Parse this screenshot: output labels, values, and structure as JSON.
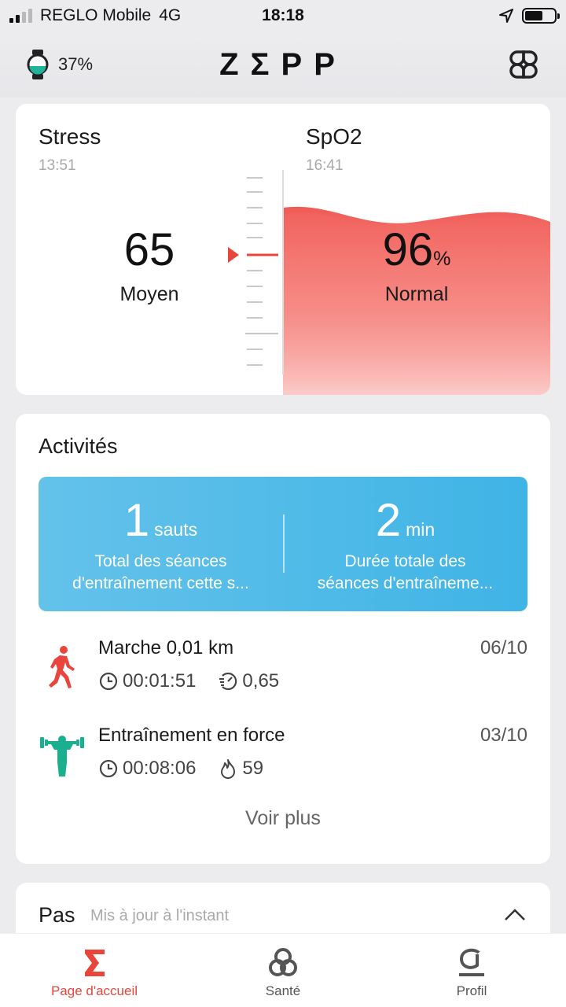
{
  "status_bar": {
    "carrier": "REGLO Mobile",
    "network": "4G",
    "time": "18:18",
    "signal_bars": 2,
    "battery_level": 0.6
  },
  "header": {
    "watch_battery": "37%",
    "logo": "ZΣPP",
    "icons": [
      "watch-icon",
      "apps-grid-icon"
    ]
  },
  "health": {
    "stress": {
      "title": "Stress",
      "time": "13:51",
      "value": "65",
      "level": "Moyen"
    },
    "spo2": {
      "title": "SpO2",
      "time": "16:41",
      "value": "96",
      "unit": "%",
      "level": "Normal"
    },
    "colors": {
      "accent": "#f0605a",
      "pointer": "#e8453c"
    }
  },
  "activities": {
    "title": "Activités",
    "banner": {
      "left": {
        "value": "1",
        "unit": "sauts",
        "desc_line1": "Total des séances",
        "desc_line2": "d'entraînement cette s..."
      },
      "right": {
        "value": "2",
        "unit": "min",
        "desc_line1": "Durée totale des",
        "desc_line2": "séances d'entraîneme..."
      },
      "color": "#4bb8e8"
    },
    "items": [
      {
        "name": "Marche 0,01 km",
        "date": "06/10",
        "duration": "00:01:51",
        "second_stat": "0,65",
        "icon": "walking-icon",
        "second_icon": "pace-icon",
        "color": "#e8453c"
      },
      {
        "name": "Entraînement en force",
        "date": "03/10",
        "duration": "00:08:06",
        "second_stat": "59",
        "icon": "weightlifting-icon",
        "second_icon": "flame-icon",
        "color": "#1aaf8e"
      }
    ],
    "more": "Voir plus"
  },
  "steps": {
    "title": "Pas",
    "subtitle": "Mis à jour à l'instant"
  },
  "bottom_nav": {
    "items": [
      {
        "label": "Page d'accueil",
        "icon": "sigma-home-icon",
        "active": true
      },
      {
        "label": "Santé",
        "icon": "health-icon",
        "active": false
      },
      {
        "label": "Profil",
        "icon": "profile-icon",
        "active": false
      }
    ]
  }
}
